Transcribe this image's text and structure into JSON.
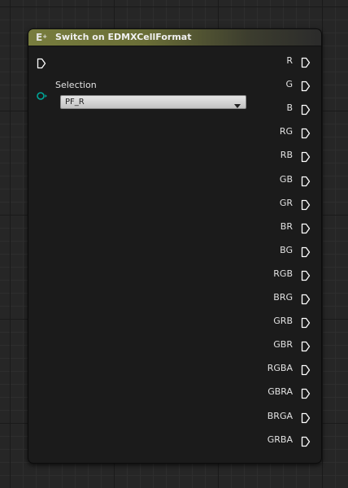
{
  "node": {
    "title": "Switch on EDMXCellFormat",
    "icon_name": "switch-function-icon",
    "icon_glyph": "E",
    "icon_super": "+",
    "header_color": "#787d3e",
    "selection_label": "Selection",
    "selection_value": "PF_R"
  },
  "outputs": [
    {
      "label": "R"
    },
    {
      "label": "G"
    },
    {
      "label": "B"
    },
    {
      "label": "RG"
    },
    {
      "label": "RB"
    },
    {
      "label": "GB"
    },
    {
      "label": "GR"
    },
    {
      "label": "BR"
    },
    {
      "label": "BG"
    },
    {
      "label": "RGB"
    },
    {
      "label": "BRG"
    },
    {
      "label": "GRB"
    },
    {
      "label": "GBR"
    },
    {
      "label": "RGBA"
    },
    {
      "label": "GBRA"
    },
    {
      "label": "BRGA"
    },
    {
      "label": "GRBA"
    }
  ],
  "colors": {
    "grid_background": "#262626",
    "node_body": "#1b1b1b",
    "exec_pin": "#ffffff",
    "enum_pin": "#00a89a"
  }
}
